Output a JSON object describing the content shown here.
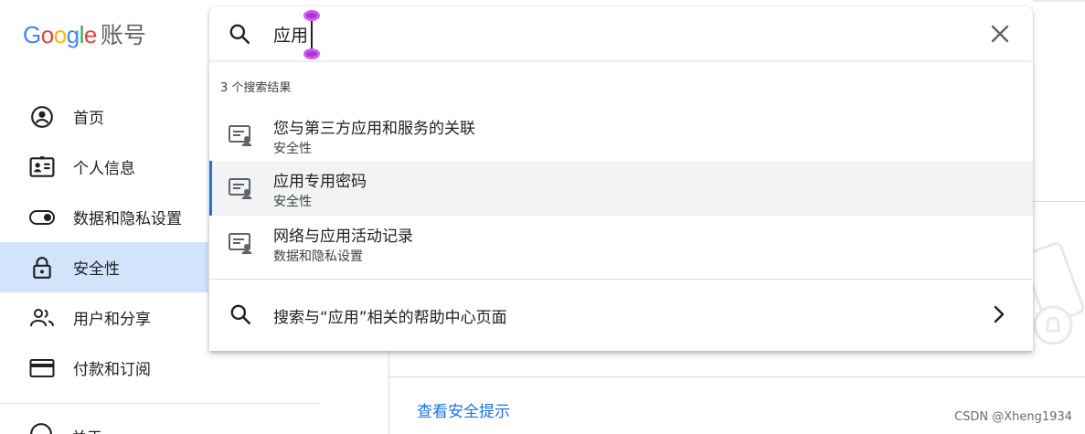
{
  "app": {
    "logo_google": "Google",
    "logo_suffix": "账号",
    "colors": {
      "blue": "#4285F4",
      "red": "#EA4335",
      "yellow": "#FBBC05",
      "green": "#34A853"
    }
  },
  "search": {
    "value": "应用",
    "clear_icon": "close-icon",
    "search_icon": "search-icon",
    "result_count": "3 个搜索结果",
    "results": [
      {
        "title": "您与第三方应用和服务的关联",
        "subtitle": "安全性",
        "icon": "settings-account-icon"
      },
      {
        "title": "应用专用密码",
        "subtitle": "安全性",
        "icon": "settings-account-icon"
      },
      {
        "title": "网络与应用活动记录",
        "subtitle": "数据和隐私设置",
        "icon": "settings-account-icon"
      }
    ],
    "help_label": "搜索与“应用”相关的帮助中心页面"
  },
  "sidebar": {
    "items": [
      {
        "label": "首页",
        "icon": "account-circle-icon"
      },
      {
        "label": "个人信息",
        "icon": "contact-card-icon"
      },
      {
        "label": "数据和隐私设置",
        "icon": "toggle-icon"
      },
      {
        "label": "安全性",
        "icon": "lock-icon",
        "active": true
      },
      {
        "label": "用户和分享",
        "icon": "people-icon"
      },
      {
        "label": "付款和订阅",
        "icon": "credit-card-icon"
      }
    ],
    "cut_item": {
      "label": "关于",
      "icon": "info-icon"
    }
  },
  "content": {
    "tips_link": "查看安全提示"
  },
  "watermark": "CSDN @Xheng1934",
  "accent": "#1a73e8",
  "active_bg": "#d2e3fc"
}
